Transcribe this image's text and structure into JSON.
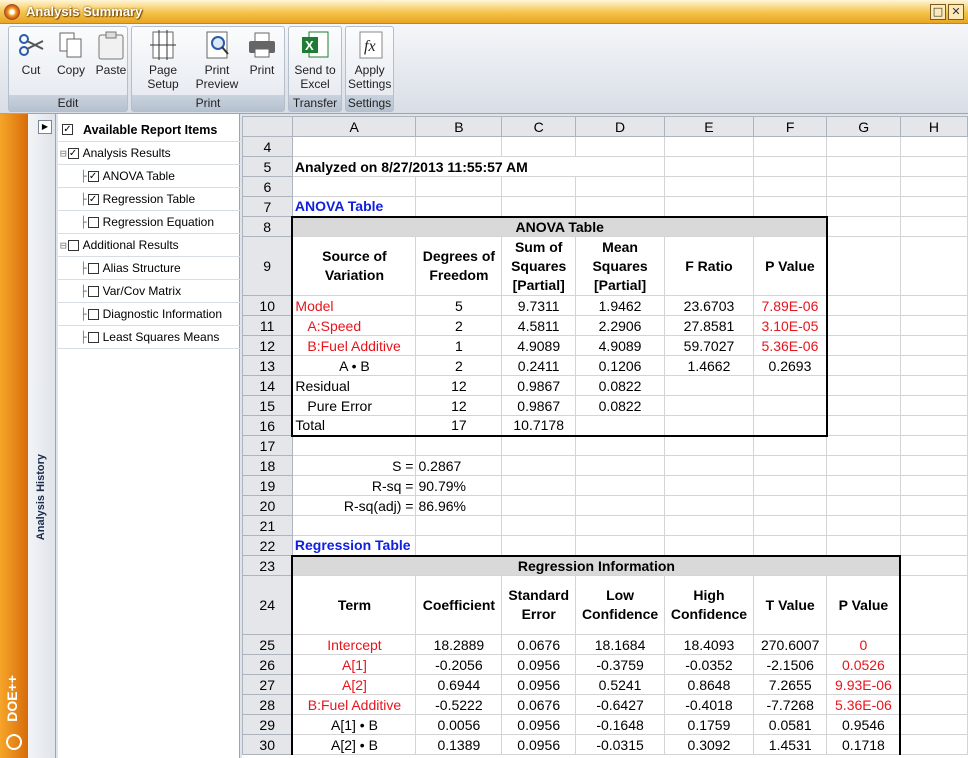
{
  "window": {
    "title": "Analysis Summary"
  },
  "ribbon": {
    "groups": [
      {
        "label": "Edit",
        "buttons": [
          "Cut",
          "Copy",
          "Paste"
        ]
      },
      {
        "label": "Print",
        "buttons": [
          "Page Setup",
          "Print Preview",
          "Print"
        ]
      },
      {
        "label": "Transfer",
        "buttons": [
          "Send to Excel"
        ]
      },
      {
        "label": "Settings",
        "buttons": [
          "Apply Settings"
        ]
      }
    ]
  },
  "left_strip": {
    "brand": "DOE++",
    "history_label": "Analysis History"
  },
  "tree": {
    "header": "Available Report Items",
    "items": [
      {
        "label": "Analysis Results",
        "checked": true,
        "level": 0
      },
      {
        "label": "ANOVA Table",
        "checked": true,
        "level": 1
      },
      {
        "label": "Regression Table",
        "checked": true,
        "level": 1
      },
      {
        "label": "Regression Equation",
        "checked": false,
        "level": 1
      },
      {
        "label": "Additional Results",
        "checked": false,
        "level": 0
      },
      {
        "label": "Alias Structure",
        "checked": false,
        "level": 1
      },
      {
        "label": "Var/Cov Matrix",
        "checked": false,
        "level": 1
      },
      {
        "label": "Diagnostic Information",
        "checked": false,
        "level": 1
      },
      {
        "label": "Least Squares Means",
        "checked": false,
        "level": 1
      }
    ]
  },
  "sheet": {
    "columns": [
      "A",
      "B",
      "C",
      "D",
      "E",
      "F",
      "G",
      "H"
    ],
    "rows": [
      "4",
      "5",
      "6",
      "7",
      "8",
      "9",
      "10",
      "11",
      "12",
      "13",
      "14",
      "15",
      "16",
      "17",
      "18",
      "19",
      "20",
      "21",
      "22",
      "23",
      "24",
      "25",
      "26",
      "27",
      "28",
      "29",
      "30"
    ],
    "analyzed": "Analyzed on 8/27/2013 11:55:57 AM",
    "anova_title": "ANOVA Table",
    "anova_header": "ANOVA Table",
    "anova_cols": [
      "Source of Variation",
      "Degrees of Freedom",
      "Sum of Squares [Partial]",
      "Mean Squares [Partial]",
      "F Ratio",
      "P Value"
    ],
    "anova_rows": [
      [
        "Model",
        "5",
        "9.7311",
        "1.9462",
        "23.6703",
        "7.89E-06"
      ],
      [
        "A:Speed",
        "2",
        "4.5811",
        "2.2906",
        "27.8581",
        "3.10E-05"
      ],
      [
        "B:Fuel Additive",
        "1",
        "4.9089",
        "4.9089",
        "59.7027",
        "5.36E-06"
      ],
      [
        "A • B",
        "2",
        "0.2411",
        "0.1206",
        "1.4662",
        "0.2693"
      ],
      [
        "Residual",
        "12",
        "0.9867",
        "0.0822",
        "",
        ""
      ],
      [
        "Pure Error",
        "12",
        "0.9867",
        "0.0822",
        "",
        ""
      ],
      [
        "Total",
        "17",
        "10.7178",
        "",
        "",
        ""
      ]
    ],
    "stats": [
      [
        "S =",
        "0.2867"
      ],
      [
        "R-sq =",
        "90.79%"
      ],
      [
        "R-sq(adj) =",
        "86.96%"
      ]
    ],
    "reg_title": "Regression Table",
    "reg_header": "Regression Information",
    "reg_cols": [
      "Term",
      "Coefficient",
      "Standard Error",
      "Low Confidence",
      "High Confidence",
      "T Value",
      "P Value"
    ],
    "reg_rows": [
      [
        "Intercept",
        "18.2889",
        "0.0676",
        "18.1684",
        "18.4093",
        "270.6007",
        "0"
      ],
      [
        "A[1]",
        "-0.2056",
        "0.0956",
        "-0.3759",
        "-0.0352",
        "-2.1506",
        "0.0526"
      ],
      [
        "A[2]",
        "0.6944",
        "0.0956",
        "0.5241",
        "0.8648",
        "7.2655",
        "9.93E-06"
      ],
      [
        "B:Fuel Additive",
        "-0.5222",
        "0.0676",
        "-0.6427",
        "-0.4018",
        "-7.7268",
        "5.36E-06"
      ],
      [
        "A[1] • B",
        "0.0056",
        "0.0956",
        "-0.1648",
        "0.1759",
        "0.0581",
        "0.9546"
      ],
      [
        "A[2] • B",
        "0.1389",
        "0.0956",
        "-0.0315",
        "0.3092",
        "1.4531",
        "0.1718"
      ]
    ]
  }
}
